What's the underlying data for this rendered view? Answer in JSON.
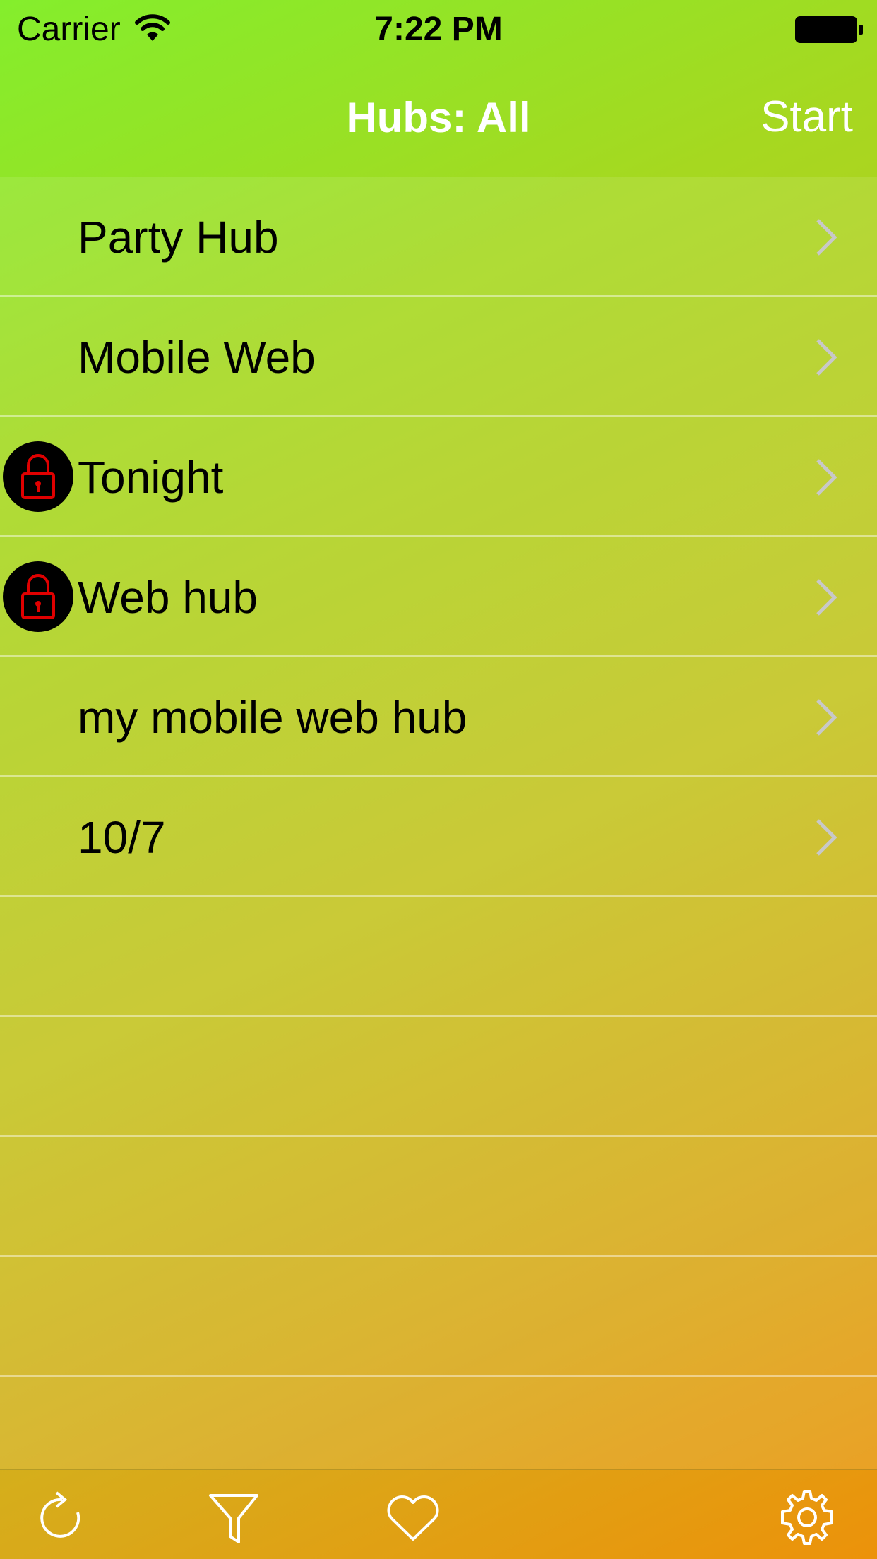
{
  "status_bar": {
    "carrier": "Carrier",
    "time": "7:22 PM",
    "wifi_icon": "wifi-icon",
    "battery_icon": "battery-icon"
  },
  "nav": {
    "title": "Hubs: All",
    "right_button": "Start"
  },
  "hubs": [
    {
      "label": "Party Hub",
      "locked": false
    },
    {
      "label": "Mobile Web",
      "locked": false
    },
    {
      "label": "Tonight",
      "locked": true
    },
    {
      "label": "Web hub",
      "locked": true
    },
    {
      "label": "my mobile web hub",
      "locked": false
    },
    {
      "label": "10/7",
      "locked": false
    }
  ],
  "colors": {
    "lock_red": "#e00000",
    "chevron": "#c8c8c8",
    "nav_text": "#ffffff"
  },
  "tab_bar": {
    "icons": [
      "refresh-icon",
      "filter-icon",
      "heart-icon",
      "gear-icon"
    ]
  }
}
